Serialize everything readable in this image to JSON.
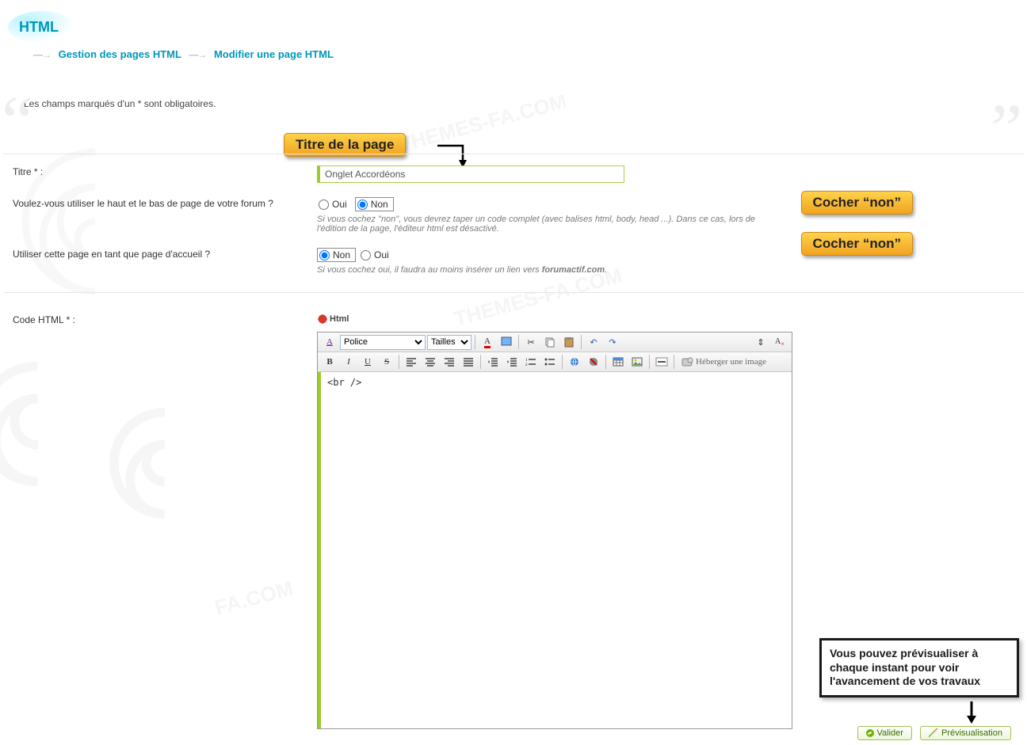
{
  "header": {
    "tab": "HTML",
    "crumb1": "Gestion des pages HTML",
    "crumb2": "Modifier une page HTML"
  },
  "notice": "Les champs marqués d'un * sont obligatoires.",
  "form": {
    "title_label": "Titre * :",
    "title_value": "Onglet Accordéons",
    "q_header_label": "Voulez-vous utiliser le haut et le bas de page de votre forum ?",
    "q_header_opts": {
      "yes": "Oui",
      "no": "Non"
    },
    "q_header_help": "Si vous cochez \"non\", vous devrez taper un code complet (avec balises html, body, head ...). Dans ce cas, lors de l'édition de la page, l'éditeur html est désactivé.",
    "q_home_label": "Utiliser cette page en tant que page d'accueil ?",
    "q_home_opts": {
      "yes": "Oui",
      "no": "Non"
    },
    "q_home_help_pre": "Si vous cochez oui, il faudra au moins insérer un lien vers ",
    "q_home_help_b": "forumactif.com",
    "q_home_help_post": "."
  },
  "callouts": {
    "title": "Titre de la page",
    "check_non_1": "Cocher “non”",
    "check_non_2": "Cocher “non”",
    "preview": "Vous pouvez prévisualiser à chaque instant pour voir l'avancement de vos travaux"
  },
  "editor": {
    "label": "Code HTML * :",
    "tag": "Html",
    "font_select": "Police",
    "size_select": "Tailles",
    "host_image": "Héberger une image",
    "content": "<br />"
  },
  "buttons": {
    "validate": "Valider",
    "preview": "Prévisualisation"
  }
}
